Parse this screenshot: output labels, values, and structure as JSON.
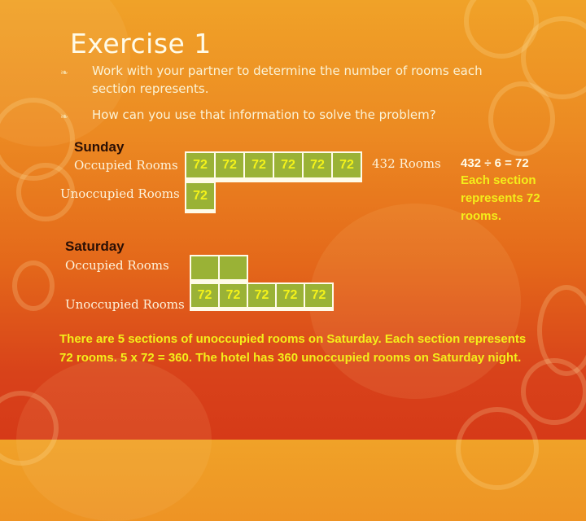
{
  "slide": {
    "title": "Exercise 1",
    "bullets": [
      {
        "icon": "ornament-bullet-icon",
        "text": "Work with your partner to determine the number of rooms each section represents."
      },
      {
        "icon": "ornament-bullet-icon",
        "text": "How can you use that information to solve the problem?"
      }
    ],
    "sunday": {
      "label": "Sunday",
      "occupied_label": "Occupied Rooms",
      "unoccupied_label": "Unoccupied Rooms",
      "occupied_cells": [
        "72",
        "72",
        "72",
        "72",
        "72",
        "72"
      ],
      "unoccupied_cells": [
        "72"
      ],
      "occupied_total": "432 Rooms",
      "calculation": "432 ÷ 6 = 72",
      "explanation": "Each section represents 72 rooms."
    },
    "saturday": {
      "label": "Saturday",
      "occupied_label": "Occupied Rooms",
      "unoccupied_label": "Unoccupied Rooms",
      "occupied_cells": [
        "",
        ""
      ],
      "unoccupied_cells": [
        "72",
        "72",
        "72",
        "72",
        "72"
      ]
    },
    "conclusion": "There are 5 sections of unoccupied rooms on Saturday. Each section represents 72 rooms.  5 x 72 = 360.  The hotel has 360 unoccupied rooms on Saturday night.",
    "colors": {
      "cell_fill": "#9ab236",
      "cell_text": "#f4f21a",
      "highlight_text": "#f4ee1a",
      "background_top": "#f0a228",
      "background_bottom": "#d63a18"
    }
  }
}
